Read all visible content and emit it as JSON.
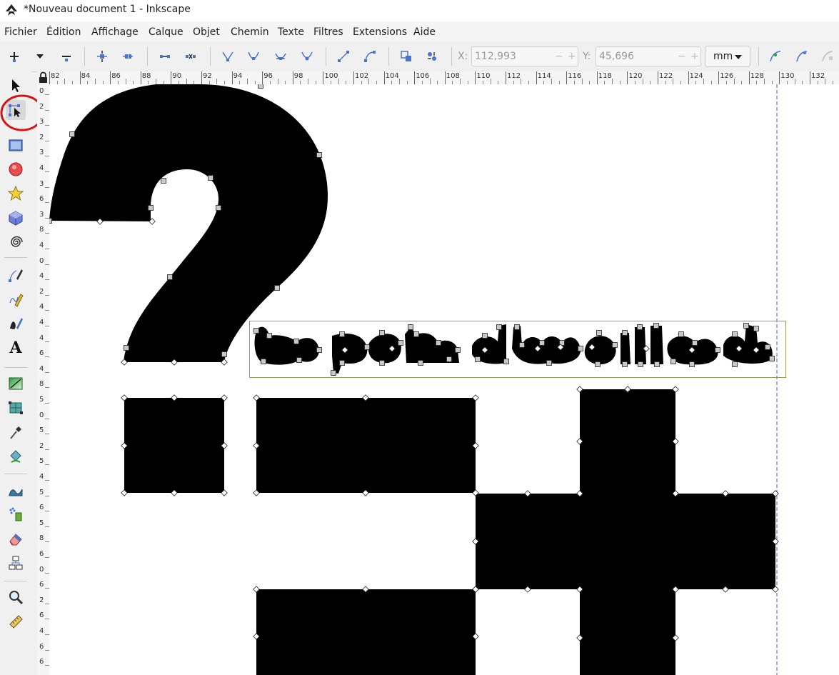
{
  "window": {
    "title": "*Nouveau document 1 - Inkscape",
    "app_icon": "inkscape-logo-icon"
  },
  "menu": [
    {
      "id": "fichier",
      "label": "Fichier"
    },
    {
      "id": "edition",
      "label": "Édition"
    },
    {
      "id": "affichage",
      "label": "Affichage"
    },
    {
      "id": "calque",
      "label": "Calque"
    },
    {
      "id": "objet",
      "label": "Objet"
    },
    {
      "id": "chemin",
      "label": "Chemin"
    },
    {
      "id": "texte",
      "label": "Texte"
    },
    {
      "id": "filtres",
      "label": "Filtres"
    },
    {
      "id": "extensions",
      "label": "Extensions"
    },
    {
      "id": "aide",
      "label": "Aide"
    }
  ],
  "toolbar": {
    "icons": [
      "insert-node-icon",
      "insert-node-menu-icon",
      "delete-node-icon",
      "join-nodes-icon",
      "break-path-icon",
      "join-segment-icon",
      "delete-segment-icon",
      "node-cusp-icon",
      "node-smooth-icon",
      "node-symmetric-icon",
      "node-auto-icon",
      "segment-line-icon",
      "segment-curve-icon",
      "object-to-path-icon",
      "stroke-to-path-icon",
      "clip-path-edit-icon",
      "mask-edit-icon",
      "show-handles-icon"
    ],
    "x_label": "X:",
    "x_value": "112,993",
    "y_label": "Y:",
    "y_value": "45,696",
    "spin_minus": "−",
    "spin_plus": "+",
    "unit": "mm"
  },
  "tools": [
    {
      "id": "selector",
      "icon": "selector-arrow-icon"
    },
    {
      "id": "node",
      "icon": "node-tool-icon",
      "active": true
    },
    {
      "id": "rect",
      "icon": "rectangle-icon"
    },
    {
      "id": "circle",
      "icon": "circle-icon"
    },
    {
      "id": "star",
      "icon": "star-icon"
    },
    {
      "id": "box3d",
      "icon": "box-3d-icon"
    },
    {
      "id": "spiral",
      "icon": "spiral-icon"
    },
    {
      "id": "pen",
      "icon": "pen-icon"
    },
    {
      "id": "pencil",
      "icon": "pencil-icon"
    },
    {
      "id": "calligraphy",
      "icon": "calligraphy-icon"
    },
    {
      "id": "text",
      "icon": "text-icon",
      "glyph": "A"
    },
    {
      "id": "gradient",
      "icon": "gradient-icon"
    },
    {
      "id": "mesh",
      "icon": "mesh-icon"
    },
    {
      "id": "dropper",
      "icon": "dropper-icon"
    },
    {
      "id": "paintbucket",
      "icon": "paint-bucket-icon"
    },
    {
      "id": "tweak",
      "icon": "tweak-icon"
    },
    {
      "id": "spray",
      "icon": "spray-icon"
    },
    {
      "id": "eraser",
      "icon": "eraser-icon"
    },
    {
      "id": "connector",
      "icon": "connector-icon"
    },
    {
      "id": "zoom",
      "icon": "zoom-icon"
    },
    {
      "id": "measure",
      "icon": "measure-icon"
    }
  ],
  "ruler": {
    "h_labels": [
      "82",
      "84",
      "86",
      "88",
      "90",
      "92",
      "94",
      "96",
      "98",
      "100",
      "102",
      "104",
      "106",
      "108",
      "110",
      "112",
      "114",
      "116",
      "118",
      "120",
      "122",
      "124",
      "126",
      "128",
      "130",
      "132"
    ],
    "v_labels": [
      "0",
      "2",
      "3",
      "2",
      "3",
      "4",
      "3",
      "6",
      "3",
      "8",
      "4",
      "0",
      "4",
      "2",
      "4",
      "4",
      "4",
      "6",
      "4",
      "8",
      "5",
      "0",
      "5",
      "2",
      "5",
      "4",
      "5",
      "6",
      "5",
      "8",
      "6",
      "0",
      "6",
      "2",
      "6",
      "4",
      "6",
      "6"
    ]
  },
  "colors": {
    "highlight_circle": "#dd1111",
    "shape_fill": "#000000",
    "guide": "#5555cc",
    "bbox": "#9b9b5a"
  }
}
